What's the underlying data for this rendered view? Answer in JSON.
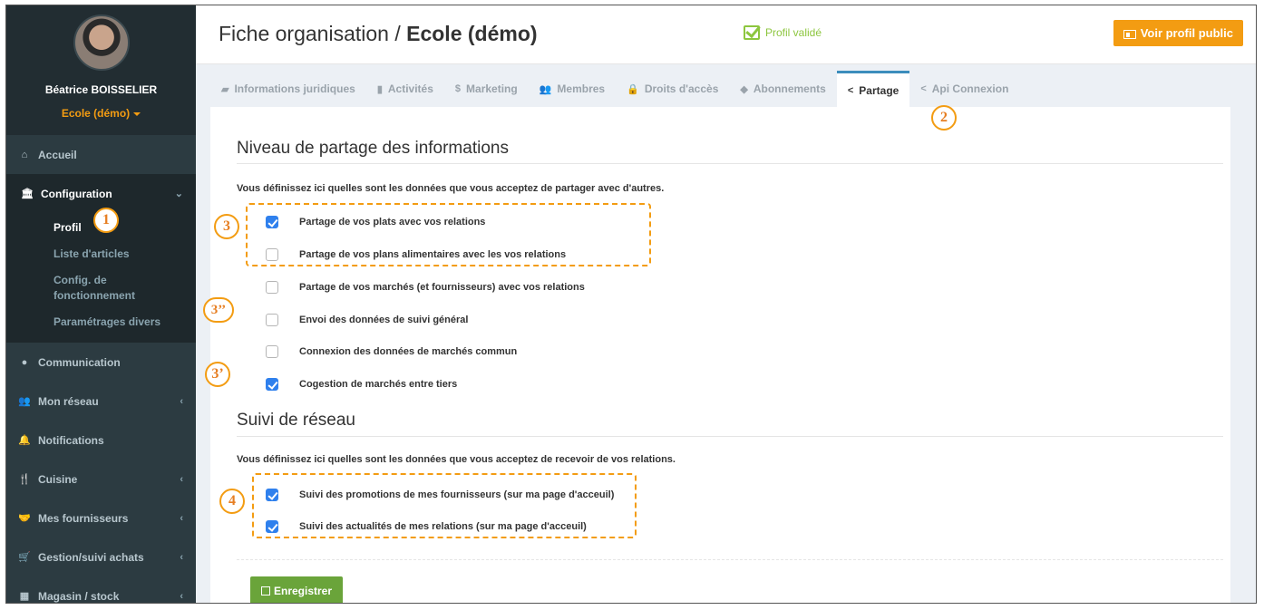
{
  "user": {
    "name": "Béatrice BOISSELIER",
    "org": "Ecole (démo)"
  },
  "sidebar": {
    "items": [
      {
        "label": "Accueil",
        "icon": "home-icon"
      },
      {
        "label": "Configuration",
        "icon": "bank-icon"
      },
      {
        "label": "Communication",
        "icon": "comments-icon"
      },
      {
        "label": "Mon réseau",
        "icon": "users-icon"
      },
      {
        "label": "Notifications",
        "icon": "bell-icon"
      },
      {
        "label": "Cuisine",
        "icon": "cutlery-icon"
      },
      {
        "label": "Mes fournisseurs",
        "icon": "handshake-icon"
      },
      {
        "label": "Gestion/suivi achats",
        "icon": "cart-icon"
      },
      {
        "label": "Magasin / stock",
        "icon": "cubes-icon"
      }
    ],
    "submenu": [
      "Profil",
      "Liste d'articles",
      "Config. de fonctionnement",
      "Paramétrages divers"
    ]
  },
  "header": {
    "title_prefix": "Fiche organisation / ",
    "title_bold": "Ecole (démo)",
    "validated": "Profil validé",
    "public_button": "Voir profil public"
  },
  "tabs": [
    {
      "label": "Informations juridiques",
      "icon": "folder-open-icon"
    },
    {
      "label": "Activités",
      "icon": "bar-chart-icon"
    },
    {
      "label": "Marketing",
      "icon": "dollar-icon"
    },
    {
      "label": "Membres",
      "icon": "users-icon"
    },
    {
      "label": "Droits d'accès",
      "icon": "lock-icon"
    },
    {
      "label": "Abonnements",
      "icon": "tag-icon"
    },
    {
      "label": "Partage",
      "icon": "share-icon",
      "active": true
    },
    {
      "label": "Api Connexion",
      "icon": "share-icon"
    }
  ],
  "sharing": {
    "title": "Niveau de partage des informations",
    "description": "Vous définissez ici quelles sont les données que vous acceptez de partager avec d'autres.",
    "options": [
      {
        "label": "Partage de vos plats avec vos relations",
        "checked": true
      },
      {
        "label": "Partage de vos plans alimentaires avec les vos relations",
        "checked": false
      },
      {
        "label": "Partage de vos marchés (et fournisseurs) avec vos relations",
        "checked": false
      },
      {
        "label": "Envoi des données de suivi général",
        "checked": false
      },
      {
        "label": "Connexion des données de marchés commun",
        "checked": false
      },
      {
        "label": "Cogestion de marchés entre tiers",
        "checked": true
      }
    ]
  },
  "network": {
    "title": "Suivi de réseau",
    "description": "Vous définissez ici quelles sont les données que vous acceptez de recevoir de vos relations.",
    "options": [
      {
        "label": "Suivi des promotions de mes fournisseurs (sur ma page d'acceuil)",
        "checked": true
      },
      {
        "label": "Suivi des actualités de mes relations (sur ma page d'acceuil)",
        "checked": true
      }
    ]
  },
  "save_button": "Enregistrer",
  "annotations": [
    "1",
    "2",
    "3",
    "3’’",
    "3’",
    "4"
  ],
  "colors": {
    "accent": "#f39c12",
    "checkbox": "#2f80ed",
    "save": "#6aa43a",
    "sidebar": "#2c3b41",
    "tab_active": "#3c8dbc"
  }
}
